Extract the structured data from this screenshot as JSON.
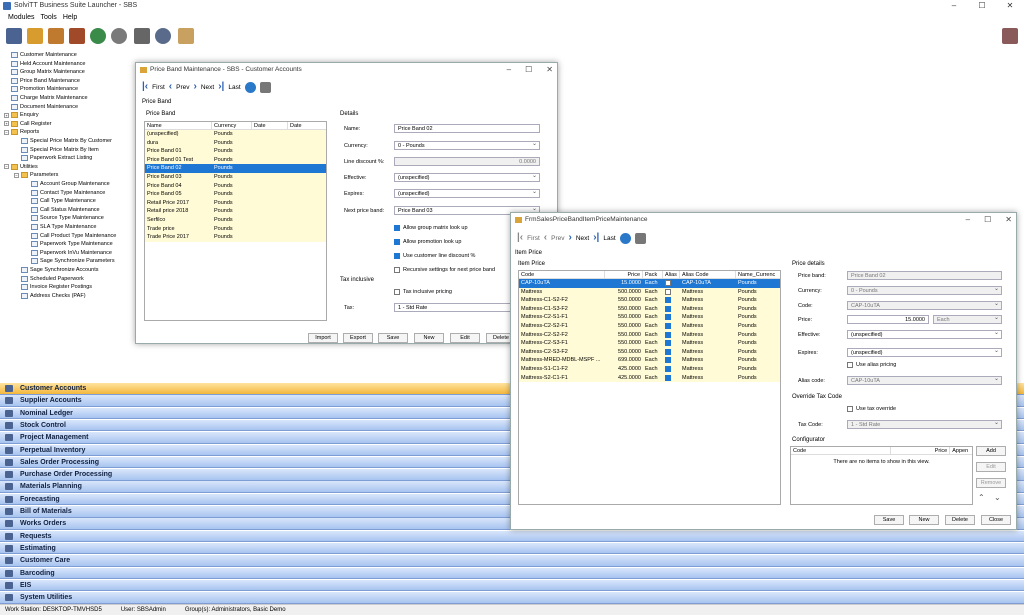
{
  "app": {
    "title": "SolviTT Business Suite Launcher - SBS"
  },
  "menu": [
    "Modules",
    "Tools",
    "Help"
  ],
  "tree": [
    {
      "label": "Customer Maintenance",
      "lvl": 0
    },
    {
      "label": "Held Account Maintenance",
      "lvl": 0
    },
    {
      "label": "Group Matrix Maintenance",
      "lvl": 0
    },
    {
      "label": "Price Band Maintenance",
      "lvl": 0
    },
    {
      "label": "Promotion Maintenance",
      "lvl": 0
    },
    {
      "label": "Charge Matrix Maintenance",
      "lvl": 0
    },
    {
      "label": "Document Maintenance",
      "lvl": 0
    },
    {
      "label": "Enquiry",
      "lvl": 0,
      "folder": true,
      "exp": "+"
    },
    {
      "label": "Call Register",
      "lvl": 0,
      "folder": true,
      "exp": "+"
    },
    {
      "label": "Reports",
      "lvl": 0,
      "folder": true,
      "exp": "−"
    },
    {
      "label": "Special Price Matrix By Customer",
      "lvl": 1
    },
    {
      "label": "Special Price Matrix By Item",
      "lvl": 1
    },
    {
      "label": "Paperwork Extract Listing",
      "lvl": 1
    },
    {
      "label": "Utilities",
      "lvl": 0,
      "folder": true,
      "exp": "−"
    },
    {
      "label": "Parameters",
      "lvl": 1,
      "folder": true,
      "exp": "−"
    },
    {
      "label": "Account Group Maintenance",
      "lvl": 2
    },
    {
      "label": "Contact Type Maintenance",
      "lvl": 2
    },
    {
      "label": "Call Type Maintenance",
      "lvl": 2
    },
    {
      "label": "Call Status Maintenance",
      "lvl": 2
    },
    {
      "label": "Source Type Maintenance",
      "lvl": 2
    },
    {
      "label": "SLA Type Maintenance",
      "lvl": 2
    },
    {
      "label": "Call Product Type Maintenance",
      "lvl": 2
    },
    {
      "label": "Paperwork Type Maintenance",
      "lvl": 2
    },
    {
      "label": "Paperwork InVu Maintenance",
      "lvl": 2
    },
    {
      "label": "Sage Synchronize Parameters",
      "lvl": 2
    },
    {
      "label": "Sage Synchronize Accounts",
      "lvl": 1
    },
    {
      "label": "Scheduled Paperwork",
      "lvl": 1
    },
    {
      "label": "Invoice Register Postings",
      "lvl": 1
    },
    {
      "label": "Address Checks (PAF)",
      "lvl": 1
    }
  ],
  "modules": [
    "Customer Accounts",
    "Supplier Accounts",
    "Nominal Ledger",
    "Stock Control",
    "Project Management",
    "Perpetual Inventory",
    "Sales Order Processing",
    "Purchase Order Processing",
    "Materials Planning",
    "Forecasting",
    "Bill of Materials",
    "Works Orders",
    "Requests",
    "Estimating",
    "Customer Care",
    "Barcoding",
    "EIS",
    "System Utilities"
  ],
  "status": {
    "workstation": "Work Station: DESKTOP-TMVHSD5",
    "user": "User: SBSAdmin",
    "groups": "Group(s): Administrators, Basic Demo"
  },
  "pbm": {
    "title": "Price Band Maintenance - SBS - Customer Accounts",
    "nav": {
      "first": "First",
      "prev": "Prev",
      "next": "Next",
      "last": "Last"
    },
    "tab": "Price Band",
    "group": "Price Band",
    "cols": [
      "Name",
      "Currency",
      "Date",
      "Date"
    ],
    "rows": [
      [
        "(unspecified)",
        "Pounds"
      ],
      [
        "dura",
        "Pounds"
      ],
      [
        "Price Band 01",
        "Pounds"
      ],
      [
        "Price Band 01 Test",
        "Pounds"
      ],
      [
        "Price Band 02",
        "Pounds"
      ],
      [
        "Price Band 03",
        "Pounds"
      ],
      [
        "Price Band 04",
        "Pounds"
      ],
      [
        "Price Band 05",
        "Pounds"
      ],
      [
        "Retail Price 2017",
        "Pounds"
      ],
      [
        "Retail price 2018",
        "Pounds"
      ],
      [
        "Serfilco",
        "Pounds"
      ],
      [
        "Trade price",
        "Pounds"
      ],
      [
        "Trade Price 2017",
        "Pounds"
      ]
    ],
    "selected_row": 4,
    "details": {
      "group": "Details",
      "name_lbl": "Name:",
      "name": "Price Band 02",
      "currency_lbl": "Currency:",
      "currency": "0 - Pounds",
      "discount_lbl": "Line discount %:",
      "discount": "0.0000",
      "effective_lbl": "Effective:",
      "effective": "(unspecified)",
      "expires_lbl": "Expires:",
      "expires": "(unspecified)",
      "next_lbl": "Next price band:",
      "next": "Price Band 03",
      "cb1": "Allow group matrix look up",
      "cb2": "Allow promotion look up",
      "cb3": "Use customer line discount %",
      "cb4": "Recursive settings for next price band",
      "tax_group": "Tax inclusive",
      "tax_cb": "Tax inclusive pricing",
      "tax_lbl": "Tax:",
      "tax": "1 - Std Rate"
    },
    "buttons": [
      "Import",
      "Export",
      "Save",
      "New",
      "Edit",
      "Delete"
    ]
  },
  "ipm": {
    "title": "FrmSalesPriceBandItemPriceMaintenance",
    "nav": {
      "first": "First",
      "prev": "Prev",
      "next": "Next",
      "last": "Last"
    },
    "tab": "Item Price",
    "group": "Item Price",
    "cols": [
      "Code",
      "Price",
      "Pack",
      "Alias",
      "Alias Code",
      "Name_Currenc"
    ],
    "rows": [
      [
        "CAP-10uTA",
        "15.0000",
        "Each",
        false,
        "CAP-10uTA",
        "Pounds"
      ],
      [
        "Mattress",
        "500.0000",
        "Each",
        false,
        "Mattress",
        "Pounds"
      ],
      [
        "Mattress-C1-S2-F2",
        "550.0000",
        "Each",
        true,
        "Mattress",
        "Pounds"
      ],
      [
        "Mattress-C1-S3-F2",
        "550.0000",
        "Each",
        true,
        "Mattress",
        "Pounds"
      ],
      [
        "Mattress-C2-S1-F1",
        "550.0000",
        "Each",
        true,
        "Mattress",
        "Pounds"
      ],
      [
        "Mattress-C2-S2-F1",
        "550.0000",
        "Each",
        true,
        "Mattress",
        "Pounds"
      ],
      [
        "Mattress-C2-S2-F2",
        "550.0000",
        "Each",
        true,
        "Mattress",
        "Pounds"
      ],
      [
        "Mattress-C2-S3-F1",
        "550.0000",
        "Each",
        true,
        "Mattress",
        "Pounds"
      ],
      [
        "Mattress-C2-S3-F2",
        "550.0000",
        "Each",
        true,
        "Mattress",
        "Pounds"
      ],
      [
        "Mattress-MRED-MDBL-MSPF ...",
        "699.0000",
        "Each",
        true,
        "Mattress",
        "Pounds"
      ],
      [
        "Mattress-S1-C1-F2",
        "425.0000",
        "Each",
        true,
        "Mattress",
        "Pounds"
      ],
      [
        "Mattress-S2-C1-F1",
        "425.0000",
        "Each",
        true,
        "Mattress",
        "Pounds"
      ]
    ],
    "details": {
      "group": "Price details",
      "band_lbl": "Price band:",
      "band": "Price Band 02",
      "currency_lbl": "Currency:",
      "currency": "0 - Pounds",
      "code_lbl": "Code:",
      "code": "CAP-10uTA",
      "price_lbl": "Price:",
      "price": "15.0000",
      "pack": "Each",
      "effective_lbl": "Effective:",
      "effective": "(unspecified)",
      "expires_lbl": "Expires:",
      "expires": "(unspecified)",
      "alias_cb": "Use alias pricing",
      "alias_lbl": "Alias code:",
      "alias": "CAP-10uTA",
      "otc_group": "Override Tax Code",
      "tax_cb": "Use tax override",
      "taxcode_lbl": "Tax Code:",
      "taxcode": "1 - Std Rate",
      "cfg_group": "Configurator",
      "cfg_cols": [
        "Code",
        "Price",
        "Appen"
      ],
      "cfg_empty": "There are no items to show in this view.",
      "cfg_btns": [
        "Add",
        "Edit",
        "Remove"
      ]
    },
    "buttons": [
      "Save",
      "New",
      "Delete",
      "Close"
    ]
  },
  "colors": {
    "module_active": "#f3b73d",
    "module_bar": "#a8c4f0",
    "selection": "#1e77d3",
    "row_highlight": "#fffbd6"
  }
}
